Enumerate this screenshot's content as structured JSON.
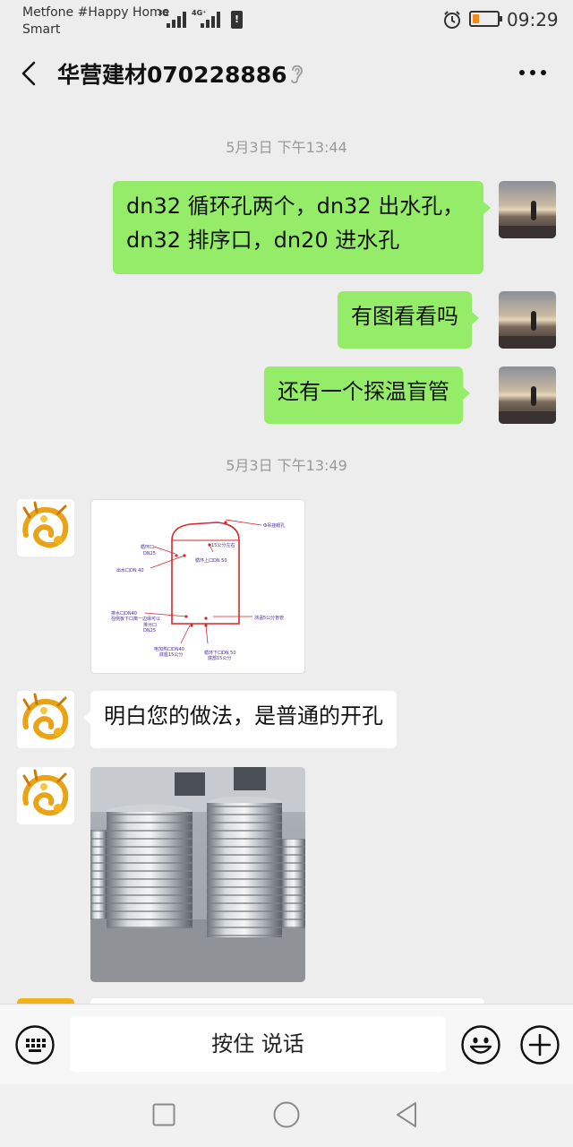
{
  "status_bar": {
    "carrier_line1": "Metfone #Happy Home",
    "carrier_line2": "Smart",
    "signal1_label": "3G",
    "signal2_label": "4G⁺",
    "battery_alert": "!",
    "time": "09:29",
    "battery_level": 0.25,
    "colors": {
      "battery_fill": "#f08a1a"
    }
  },
  "header": {
    "title": "华营建材070228886",
    "icons": [
      "back-arrow-icon",
      "ear-icon",
      "more-icon"
    ]
  },
  "messages": [
    {
      "type": "timestamp",
      "text": "5月3日 下午13:44"
    },
    {
      "type": "text",
      "from": "me",
      "line1": "dn32 循环孔两个，dn32 出水孔，",
      "line2": "dn32 排序口，dn20 进水孔"
    },
    {
      "type": "text",
      "from": "me",
      "text": "有图看看吗"
    },
    {
      "type": "text",
      "from": "me",
      "text": "还有一个探温盲管"
    },
    {
      "type": "timestamp",
      "text": "5月3日 下午13:49"
    },
    {
      "type": "image",
      "from": "them",
      "image": "tank-diagram",
      "labels": {
        "top_right": "Ф吊挂眼孔",
        "top_mid": "15公分左右",
        "left1a": "循环口",
        "left1b": "DN25",
        "mid1": "循环上口DN 50",
        "left2": "出水口DN 40",
        "left3a": "排水口DN40",
        "left3b": "在侧板下口离一边缘可以",
        "left4a": "排污口",
        "left4b": "DN25",
        "right1": "测温5公分盲管",
        "bot1a": "电加热口DN40",
        "bot1b": "底座15公分",
        "bot2a": "循环下口DN 50",
        "bot2b": "底部15公分"
      }
    },
    {
      "type": "text",
      "from": "them",
      "text": "明白您的做法，是普通的开孔"
    },
    {
      "type": "image",
      "from": "them",
      "image": "steel-water-tanks-photo"
    }
  ],
  "input_bar": {
    "voice_label": "按住 说话",
    "icons": [
      "keyboard-icon",
      "emoji-icon",
      "plus-icon"
    ]
  },
  "nav_bar": {
    "icons": [
      "recent-apps-icon",
      "home-icon",
      "back-icon"
    ]
  },
  "colors": {
    "background": "#ededed",
    "my_bubble": "#95ec69",
    "their_bubble": "#ffffff",
    "timestamp": "#999999",
    "diagram_red": "#d8262e",
    "diagram_label": "#4a2a9a"
  }
}
